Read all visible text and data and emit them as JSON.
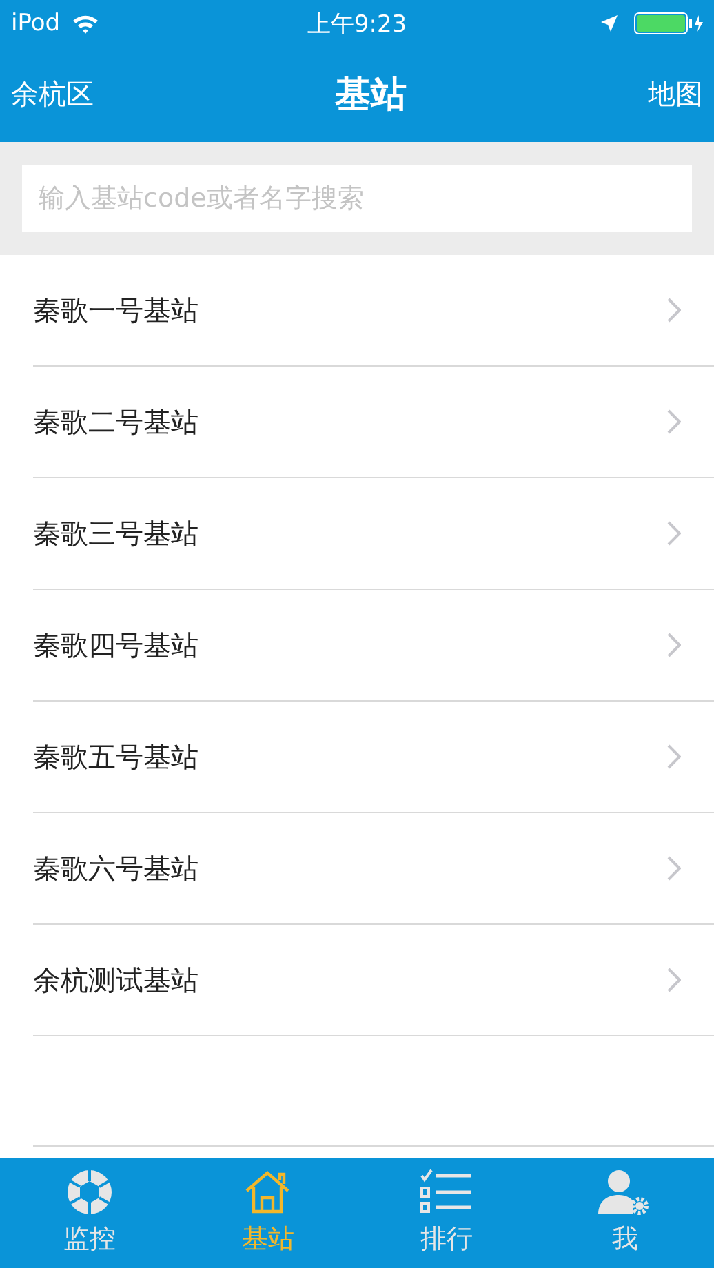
{
  "status_bar": {
    "carrier": "iPod",
    "time": "上午9:23"
  },
  "nav": {
    "left": "余杭区",
    "title": "基站",
    "right": "地图"
  },
  "search": {
    "placeholder": "输入基站code或者名字搜索"
  },
  "stations": [
    {
      "name": "秦歌一号基站"
    },
    {
      "name": "秦歌二号基站"
    },
    {
      "name": "秦歌三号基站"
    },
    {
      "name": "秦歌四号基站"
    },
    {
      "name": "秦歌五号基站"
    },
    {
      "name": "秦歌六号基站"
    },
    {
      "name": "余杭测试基站"
    }
  ],
  "tabs": [
    {
      "label": "监控",
      "kind": "aperture",
      "selected": false
    },
    {
      "label": "基站",
      "kind": "house",
      "selected": true
    },
    {
      "label": "排行",
      "kind": "list",
      "selected": false
    },
    {
      "label": "我",
      "kind": "user",
      "selected": false
    }
  ]
}
